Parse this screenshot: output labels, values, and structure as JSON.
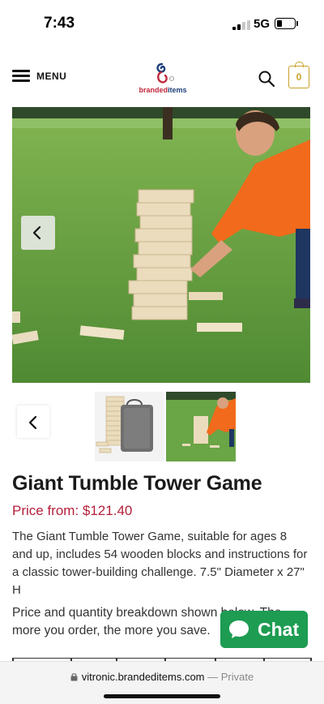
{
  "status_bar": {
    "time": "7:43",
    "network": "5G"
  },
  "header": {
    "menu_label": "MENU",
    "logo_text_a": "branded",
    "logo_text_b": "items",
    "cart_count": "0"
  },
  "product": {
    "title": "Giant Tumble Tower Game",
    "price": "Price from: $121.40",
    "description": "The Giant Tumble Tower Game, suitable for ages 8 and up, includes 54 wooden blocks and instructions for a classic tower-building challenge. 7.5\" Diameter x 27\" H",
    "breakdown_note": "Price and quantity breakdown shown below. The more you order, the more you save."
  },
  "chat": {
    "label": "Chat"
  },
  "browser": {
    "url": "vitronic.brandeditems.com",
    "mode": "— Private"
  },
  "colors": {
    "price": "#b51f3a",
    "chat": "#1d9c52",
    "cart": "#c9a227",
    "grass": "#5f9a3f"
  },
  "icons": [
    "hamburger-icon",
    "search-icon",
    "cart-icon",
    "chevron-left-icon",
    "chat-bubble-icon",
    "lock-icon"
  ]
}
